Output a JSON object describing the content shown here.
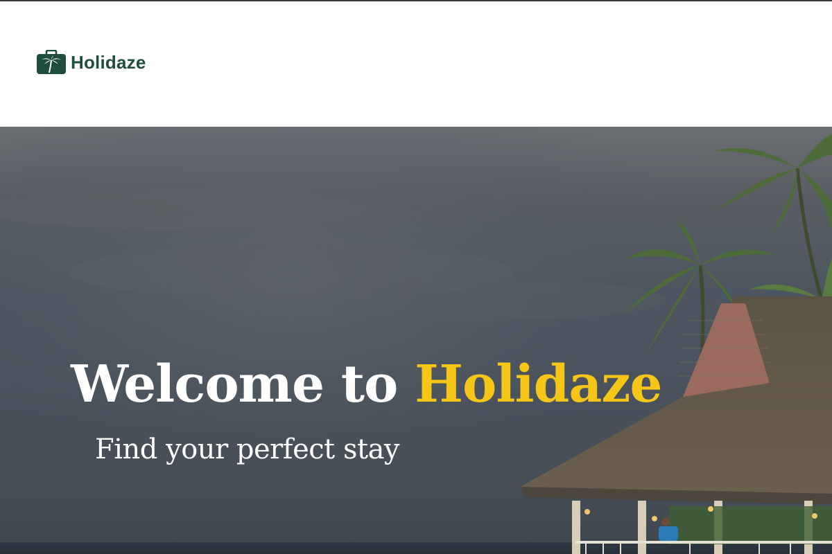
{
  "brand": {
    "name": "Holidaze",
    "icon": "suitcase-palm-icon",
    "color": "#1f4d3d"
  },
  "hero": {
    "title_prefix": "Welcome to ",
    "title_accent": "Holidaze",
    "subtitle": "Find your perfect stay",
    "accent_color": "#f5c518"
  }
}
